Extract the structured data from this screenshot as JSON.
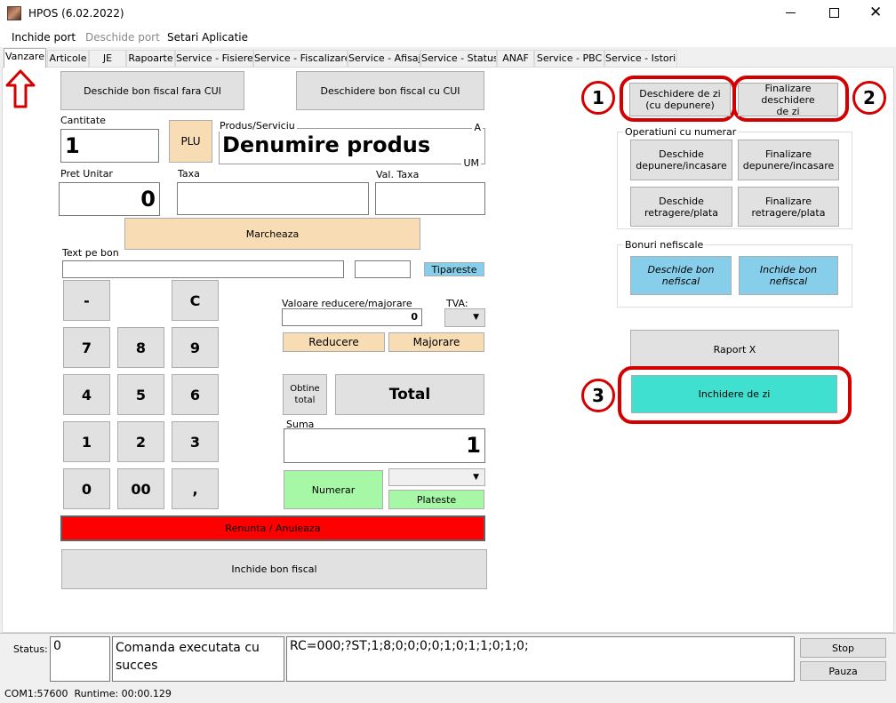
{
  "window": {
    "title": "HPOS (6.02.2022)"
  },
  "menu": {
    "items": [
      "Inchide port",
      "Deschide port",
      "Setari Aplicatie"
    ]
  },
  "tabs": [
    "Vanzare",
    "Articole",
    "JE",
    "Rapoarte",
    "Service - Fisiere",
    "Service - Fiscalizare",
    "Service - Afisaj",
    "Service - Status",
    "ANAF",
    "Service - PBC",
    "Service - Istoric"
  ],
  "sale": {
    "open_no_cui": "Deschide bon fiscal fara CUI",
    "open_cui": "Deschidere bon fiscal cu CUI",
    "cantitate_label": "Cantitate",
    "cantitate_value": "1",
    "plu": "PLU",
    "produs_label": "Produs/Serviciu",
    "produs_value": "Denumire produs",
    "produs_a": "A",
    "produs_um": "UM",
    "pret_label": "Pret Unitar",
    "pret_value": "0",
    "taxa_label": "Taxa",
    "taxa_value": "",
    "valtaxa_label": "Val. Taxa",
    "valtaxa_value": "",
    "marcheaza": "Marcheaza",
    "text_label": "Text pe bon",
    "text_value": "",
    "text_small_value": "",
    "tipareste": "Tipareste",
    "keys": [
      "-",
      "C",
      "7",
      "8",
      "9",
      "4",
      "5",
      "6",
      "1",
      "2",
      "3",
      "0",
      "00",
      ","
    ],
    "reducere_label": "Valoare reducere/majorare",
    "reducere_value": "0",
    "tva_label": "TVA:",
    "reducere_btn": "Reducere",
    "majorare_btn": "Majorare",
    "obtine_total": "Obtine\ntotal",
    "total": "Total",
    "suma_label": "Suma",
    "suma_value": "1",
    "numerar": "Numerar",
    "plateste": "Plateste",
    "renunta": "Renunta / Anuleaza",
    "inchide_bon": "Inchide bon fiscal"
  },
  "right": {
    "deschidere_zi": "Deschidere de zi\n(cu depunere)",
    "finalizare_deschidere": "Finalizare deschidere\nde zi",
    "operatiuni_title": "Operatiuni cu numerar",
    "deschide_depunere": "Deschide\ndepunere/incasare",
    "finalizare_depunere": "Finalizare\ndepunere/incasare",
    "deschide_retragere": "Deschide\nretragere/plata",
    "finalizare_retragere": "Finalizare\nretragere/plata",
    "bonuri_title": "Bonuri nefiscale",
    "deschide_nefiscal": "Deschide bon\nnefiscal",
    "inchide_nefiscal": "Inchide bon nefiscal",
    "raport_x": "Raport X",
    "inchidere_zi": "Inchidere de zi",
    "markers": [
      "1",
      "2",
      "3"
    ]
  },
  "status": {
    "label": "Status:",
    "code": "0",
    "message": "Comanda executata cu succes",
    "response": "RC=000;?ST;1;8;0;0;0;0;1;0;1;1;0;1;0;",
    "stop": "Stop",
    "pauza": "Pauza"
  },
  "footer": {
    "port_runtime": "COM1:57600  Runtime: 00:00.129"
  },
  "colors": {
    "peach": "#f8dcb4",
    "green": "#a6f7a6",
    "red": "#ff0000",
    "blue": "#87ceeb",
    "cyan": "#40e0d0",
    "annotation": "#d40000"
  }
}
